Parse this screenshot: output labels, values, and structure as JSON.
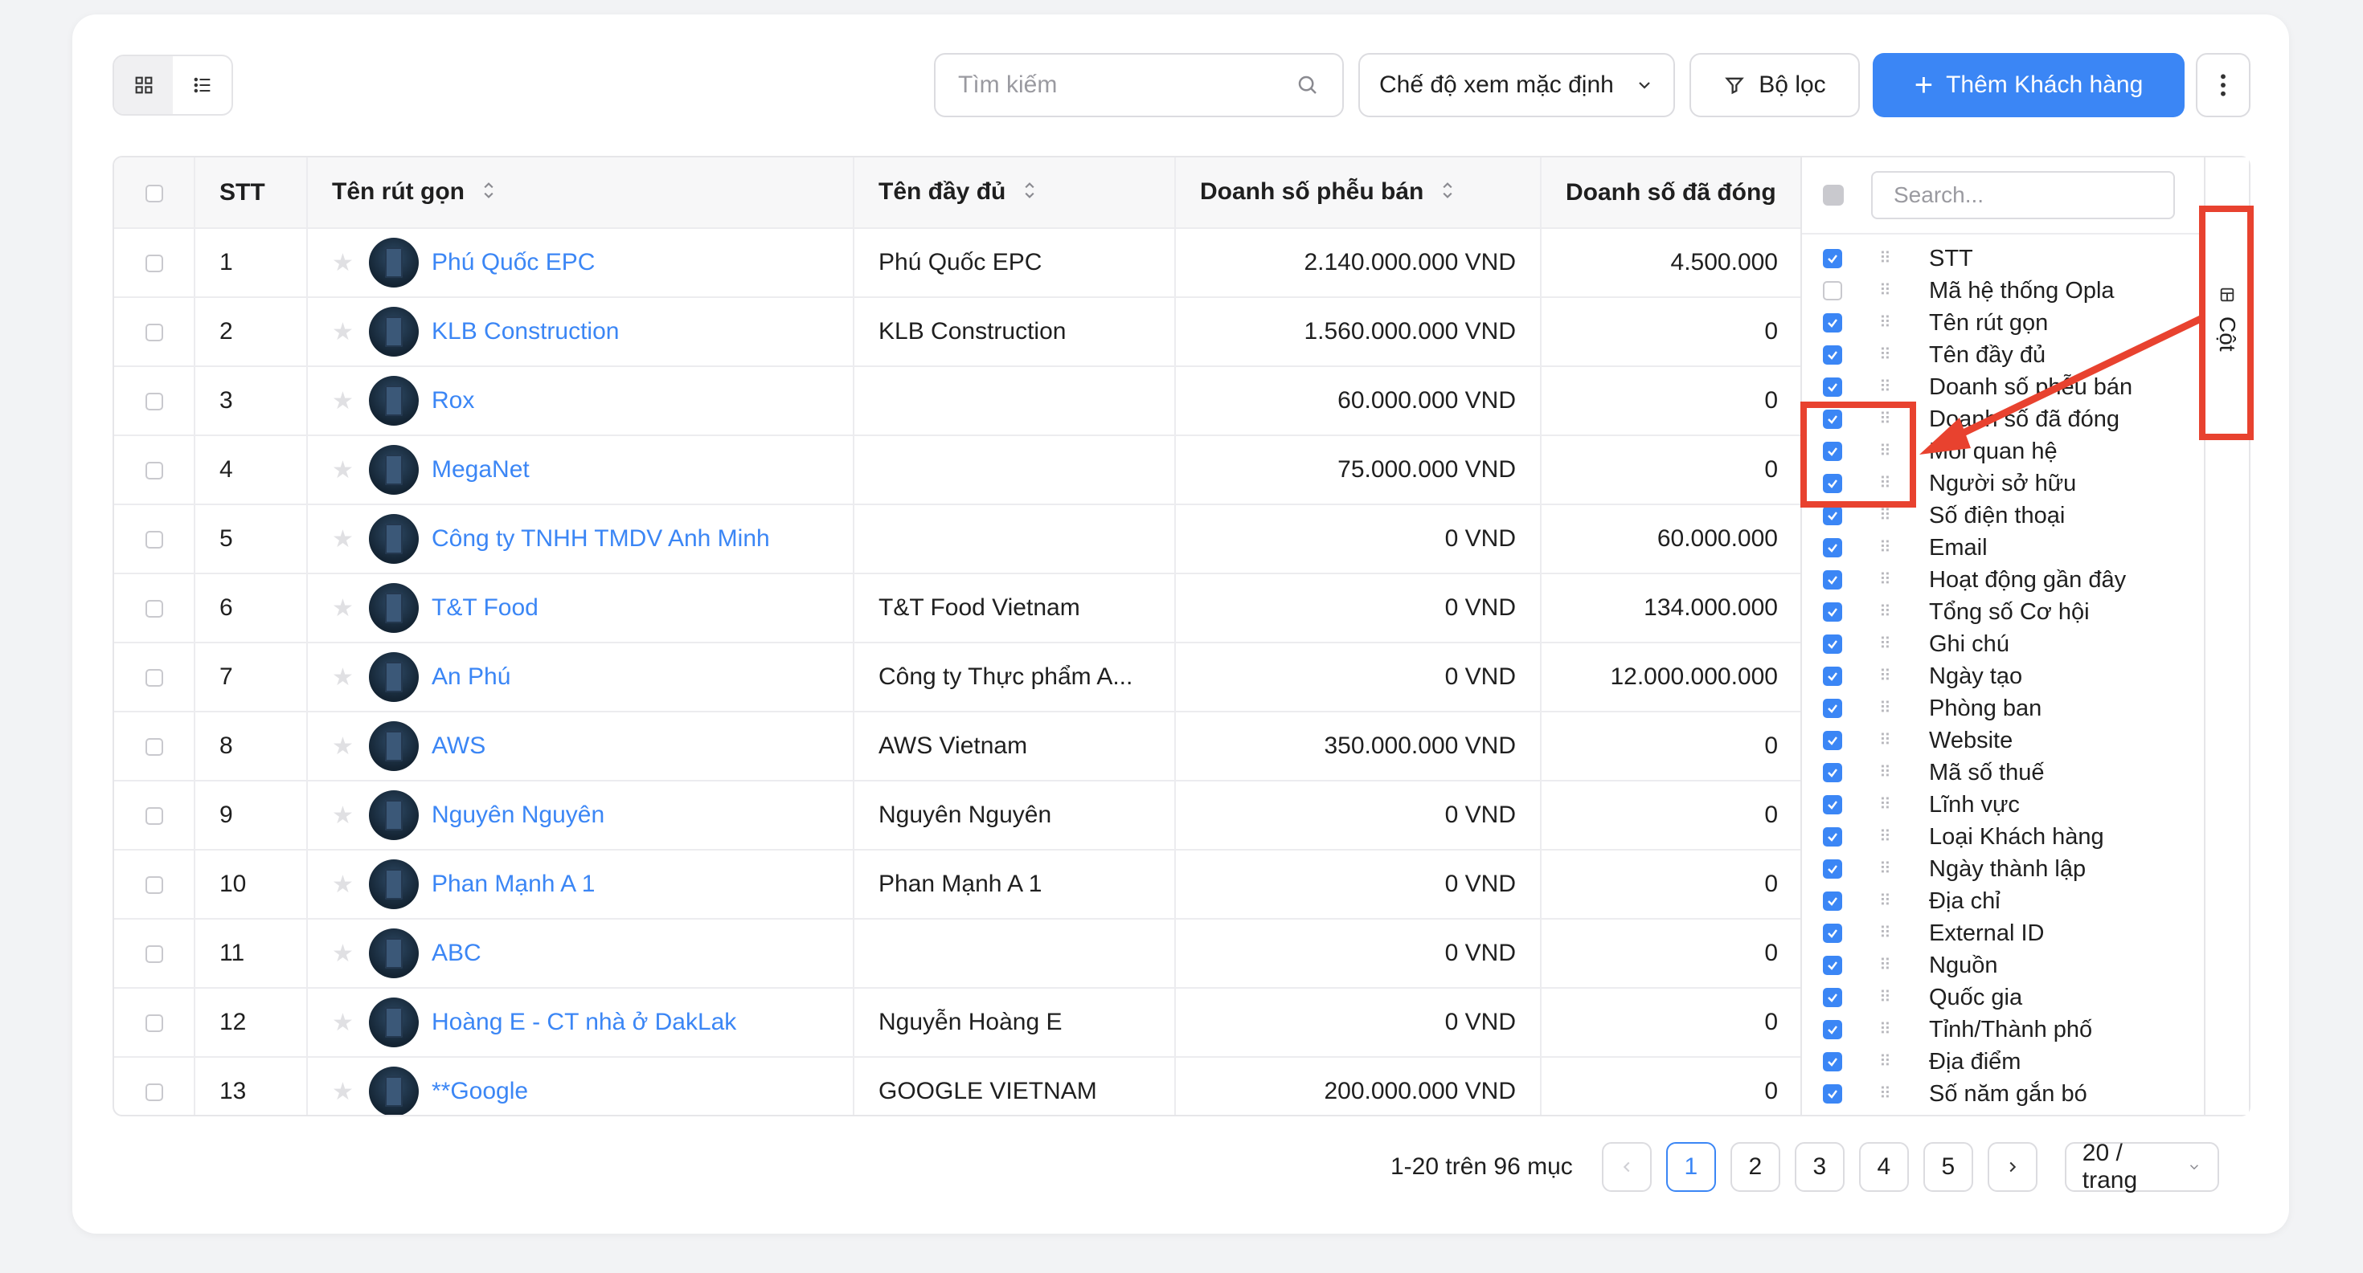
{
  "toolbar": {
    "search_placeholder": "Tìm kiếm",
    "view_mode": "Chế độ xem mặc định",
    "filter_label": "Bộ lọc",
    "add_label": "Thêm Khách hàng"
  },
  "table": {
    "columns": [
      "STT",
      "Tên rút gọn",
      "Tên đầy đủ",
      "Doanh số phễu bán",
      "Doanh số đã đóng"
    ],
    "rows": [
      {
        "stt": "1",
        "short": "Phú Quốc EPC",
        "full": "Phú Quốc EPC",
        "funnel": "2.140.000.000 VND",
        "closed": "4.500.000"
      },
      {
        "stt": "2",
        "short": "KLB Construction",
        "full": "KLB Construction",
        "funnel": "1.560.000.000 VND",
        "closed": "0"
      },
      {
        "stt": "3",
        "short": "Rox",
        "full": "",
        "funnel": "60.000.000 VND",
        "closed": "0"
      },
      {
        "stt": "4",
        "short": "MegaNet",
        "full": "",
        "funnel": "75.000.000 VND",
        "closed": "0"
      },
      {
        "stt": "5",
        "short": "Công ty TNHH TMDV Anh Minh",
        "full": "",
        "funnel": "0 VND",
        "closed": "60.000.000"
      },
      {
        "stt": "6",
        "short": "T&T Food",
        "full": "T&T Food Vietnam",
        "funnel": "0 VND",
        "closed": "134.000.000"
      },
      {
        "stt": "7",
        "short": "An Phú",
        "full": "Công ty Thực phẩm A...",
        "funnel": "0 VND",
        "closed": "12.000.000.000"
      },
      {
        "stt": "8",
        "short": "AWS",
        "full": "AWS Vietnam",
        "funnel": "350.000.000 VND",
        "closed": "0"
      },
      {
        "stt": "9",
        "short": "Nguyên Nguyên",
        "full": "Nguyên Nguyên",
        "funnel": "0 VND",
        "closed": "0"
      },
      {
        "stt": "10",
        "short": "Phan Mạnh A 1",
        "full": "Phan Mạnh A 1",
        "funnel": "0 VND",
        "closed": "0"
      },
      {
        "stt": "11",
        "short": "ABC",
        "full": "",
        "funnel": "0 VND",
        "closed": "0"
      },
      {
        "stt": "12",
        "short": "Hoàng E - CT nhà ở DakLak",
        "full": "Nguyễn Hoàng E",
        "funnel": "0 VND",
        "closed": "0"
      },
      {
        "stt": "13",
        "short": "**Google",
        "full": "GOOGLE VIETNAM",
        "funnel": "200.000.000 VND",
        "closed": "0"
      }
    ]
  },
  "column_panel": {
    "search_placeholder": "Search...",
    "tab_label": "Cột",
    "items": [
      {
        "label": "STT",
        "checked": true
      },
      {
        "label": "Mã hệ thống Opla",
        "checked": false
      },
      {
        "label": "Tên rút gọn",
        "checked": true
      },
      {
        "label": "Tên đầy đủ",
        "checked": true
      },
      {
        "label": "Doanh số phễu bán",
        "checked": true
      },
      {
        "label": "Doanh số đã đóng",
        "checked": true
      },
      {
        "label": "Mối quan hệ",
        "checked": true
      },
      {
        "label": "Người sở hữu",
        "checked": true
      },
      {
        "label": "Số điện thoại",
        "checked": true
      },
      {
        "label": "Email",
        "checked": true
      },
      {
        "label": "Hoạt động gần đây",
        "checked": true
      },
      {
        "label": "Tổng số Cơ hội",
        "checked": true
      },
      {
        "label": "Ghi chú",
        "checked": true
      },
      {
        "label": "Ngày tạo",
        "checked": true
      },
      {
        "label": "Phòng ban",
        "checked": true
      },
      {
        "label": "Website",
        "checked": true
      },
      {
        "label": "Mã số thuế",
        "checked": true
      },
      {
        "label": "Lĩnh vực",
        "checked": true
      },
      {
        "label": "Loại Khách hàng",
        "checked": true
      },
      {
        "label": "Ngày thành lập",
        "checked": true
      },
      {
        "label": "Địa chỉ",
        "checked": true
      },
      {
        "label": "External ID",
        "checked": true
      },
      {
        "label": "Nguồn",
        "checked": true
      },
      {
        "label": "Quốc gia",
        "checked": true
      },
      {
        "label": "Tỉnh/Thành phố",
        "checked": true
      },
      {
        "label": "Địa điểm",
        "checked": true
      },
      {
        "label": "Số năm gắn bó",
        "checked": true
      }
    ]
  },
  "pagination": {
    "info": "1-20 trên 96 mục",
    "pages": [
      "1",
      "2",
      "3",
      "4",
      "5"
    ],
    "current": "1",
    "page_size": "20 / trang"
  },
  "colors": {
    "accent": "#3b86f5",
    "annotation": "#e8422f"
  }
}
